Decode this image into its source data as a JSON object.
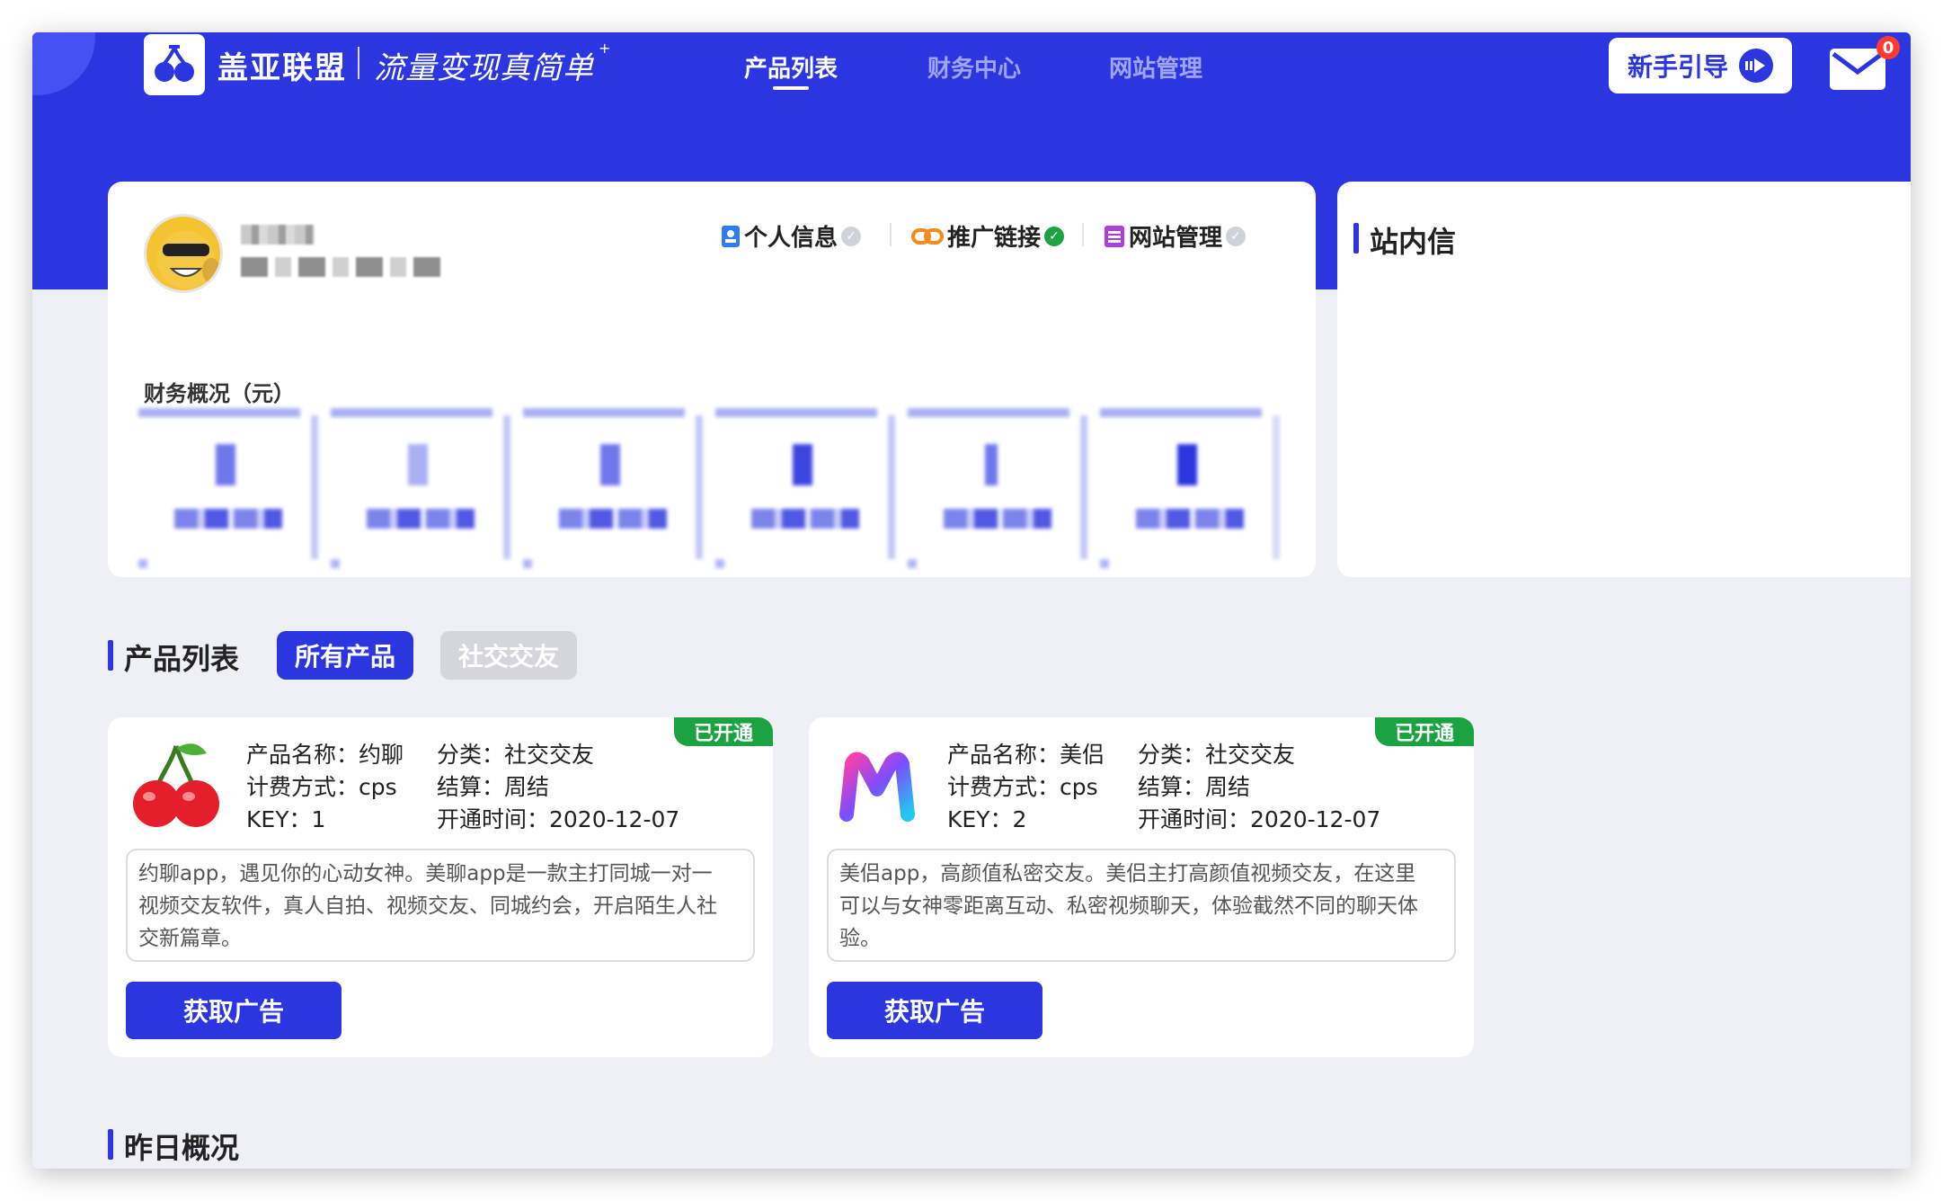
{
  "header": {
    "logo_text": "盖亚联盟",
    "slogan": "流量变现真简单",
    "slogan_mark": "+",
    "nav": [
      {
        "label": "产品列表",
        "active": true
      },
      {
        "label": "财务中心",
        "active": false
      },
      {
        "label": "网站管理",
        "active": false
      }
    ],
    "guide_label": "新手引导",
    "mail_count": "0",
    "brand_color": "#2b35e0"
  },
  "profile": {
    "links": [
      {
        "label": "个人信息",
        "icon": "id-card-icon",
        "verified": false
      },
      {
        "label": "推广链接",
        "icon": "link-icon",
        "verified": true
      },
      {
        "label": "网站管理",
        "icon": "list-icon",
        "verified": false
      }
    ],
    "finance_title": "财务概况（元）"
  },
  "messages": {
    "title": "站内信"
  },
  "products": {
    "title": "产品列表",
    "filters": [
      {
        "label": "所有产品",
        "active": true
      },
      {
        "label": "社交交友",
        "active": false
      }
    ],
    "items": [
      {
        "status": "已开通",
        "logo": "cherry-icon",
        "name": "产品名称：约聊",
        "billing": "计费方式：cps",
        "key": "KEY：1",
        "category": "分类：社交交友",
        "settle": "结算：周结",
        "open_time": "开通时间：2020-12-07",
        "desc_lines": [
          "约聊app，遇见你的心动女神。美聊app是一款主打同城一对一",
          "视频交友软件，真人自拍、视频交友、同城约会，开启陌生人社",
          "交新篇章。"
        ],
        "button": "获取广告"
      },
      {
        "status": "已开通",
        "logo": "m-letter-icon",
        "name": "产品名称：美侣",
        "billing": "计费方式：cps",
        "key": "KEY：2",
        "category": "分类：社交交友",
        "settle": "结算：周结",
        "open_time": "开通时间：2020-12-07",
        "desc_lines": [
          "美侣app，高颜值私密交友。美侣主打高颜值视频交友，在这里",
          "可以与女神零距离互动、私密视频聊天，体验截然不同的聊天体",
          "验。"
        ],
        "button": "获取广告"
      }
    ]
  },
  "yesterday": {
    "title": "昨日概况"
  }
}
